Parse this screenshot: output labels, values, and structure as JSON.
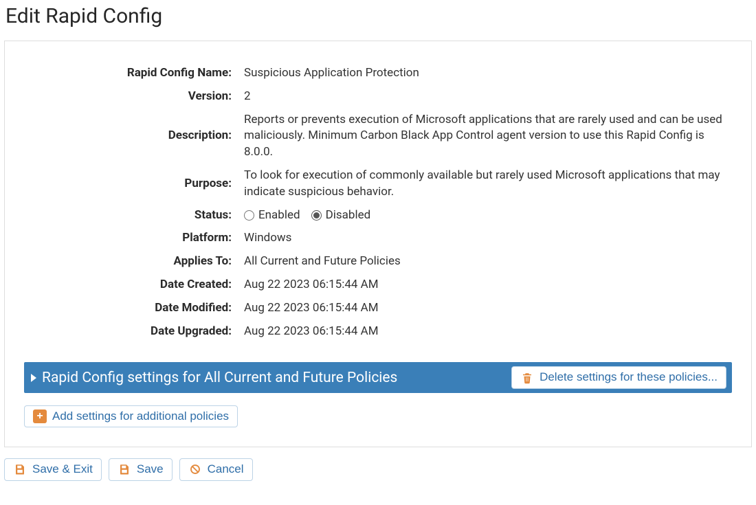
{
  "page_title": "Edit Rapid Config",
  "labels": {
    "name": "Rapid Config Name:",
    "version": "Version:",
    "description": "Description:",
    "purpose": "Purpose:",
    "status": "Status:",
    "platform": "Platform:",
    "applies_to": "Applies To:",
    "date_created": "Date Created:",
    "date_modified": "Date Modified:",
    "date_upgraded": "Date Upgraded:"
  },
  "values": {
    "name": "Suspicious Application Protection",
    "version": "2",
    "description": "Reports or prevents execution of Microsoft applications that are rarely used and can be used maliciously. Minimum Carbon Black App Control agent version to use this Rapid Config is 8.0.0.",
    "purpose": "To look for execution of commonly available but rarely used Microsoft applications that may indicate suspicious behavior.",
    "platform": "Windows",
    "applies_to": "All Current and Future Policies",
    "date_created": "Aug 22 2023 06:15:44 AM",
    "date_modified": "Aug 22 2023 06:15:44 AM",
    "date_upgraded": "Aug 22 2023 06:15:44 AM"
  },
  "status": {
    "enabled_label": "Enabled",
    "disabled_label": "Disabled",
    "selected": "Disabled"
  },
  "settings_bar": {
    "title": "Rapid Config settings for All Current and Future Policies",
    "delete_label": "Delete settings for these policies..."
  },
  "add_settings_label": "Add settings for additional policies",
  "buttons": {
    "save_exit": "Save & Exit",
    "save": "Save",
    "cancel": "Cancel"
  }
}
